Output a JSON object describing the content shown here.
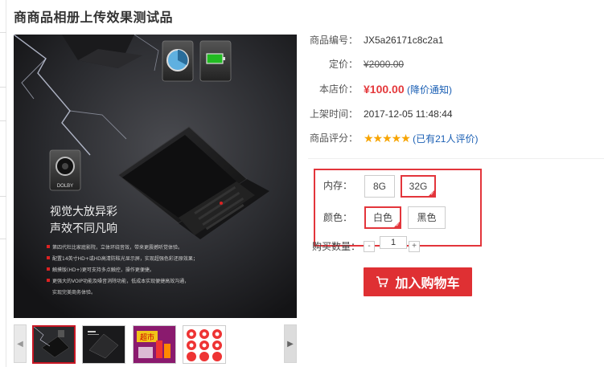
{
  "title": "商商品相册上传效果测试品",
  "product": {
    "sku_label": "商品编号：",
    "sku_value": "JX5a26171c8c2a1",
    "list_price_label": "定价：",
    "list_price_value": "¥2000.00",
    "store_price_label": "本店价：",
    "store_price_value": "¥100.00",
    "price_alert_link": "(降价通知)",
    "list_time_label": "上架时间：",
    "list_time_value": "2017-12-05 11:48:44",
    "rating_label": "商品评分：",
    "rating_stars": 5,
    "rating_link": "(已有21人评价)"
  },
  "options": {
    "memory_label": "内存：",
    "memory_choices": [
      "8G",
      "32G"
    ],
    "memory_selected": "32G",
    "color_label": "颜色：",
    "color_choices": [
      "白色",
      "黑色"
    ],
    "color_selected": "白色",
    "highlight_color": "#e3353b"
  },
  "quantity": {
    "label": "购买数量：",
    "value": "1",
    "minus": "-",
    "plus": "+"
  },
  "cart_button": {
    "label": "加入购物车",
    "color": "#df3033"
  },
  "main_image": {
    "headline_1": "视觉大放异彩",
    "headline_2": "声效不同凡响",
    "bullets": [
      "第四代杜比家庭影院，立体环绕音效，带来更震撼听觉体验。",
      "配置14英寸HD+或HD高清防眩光显示屏，实现超强色彩还原效果；",
      "触摸版(HD+)更可支持多点触控，操作更便捷。",
      "更强大的VOIP功能及噪音消除功能，低成本实现便捷高效沟通，",
      "实现完美商务体验。"
    ],
    "speaker_label": "DOLBY"
  },
  "thumbnails": {
    "prev_arrow": "◀",
    "next_arrow": "▶",
    "promo_text": "超市"
  }
}
